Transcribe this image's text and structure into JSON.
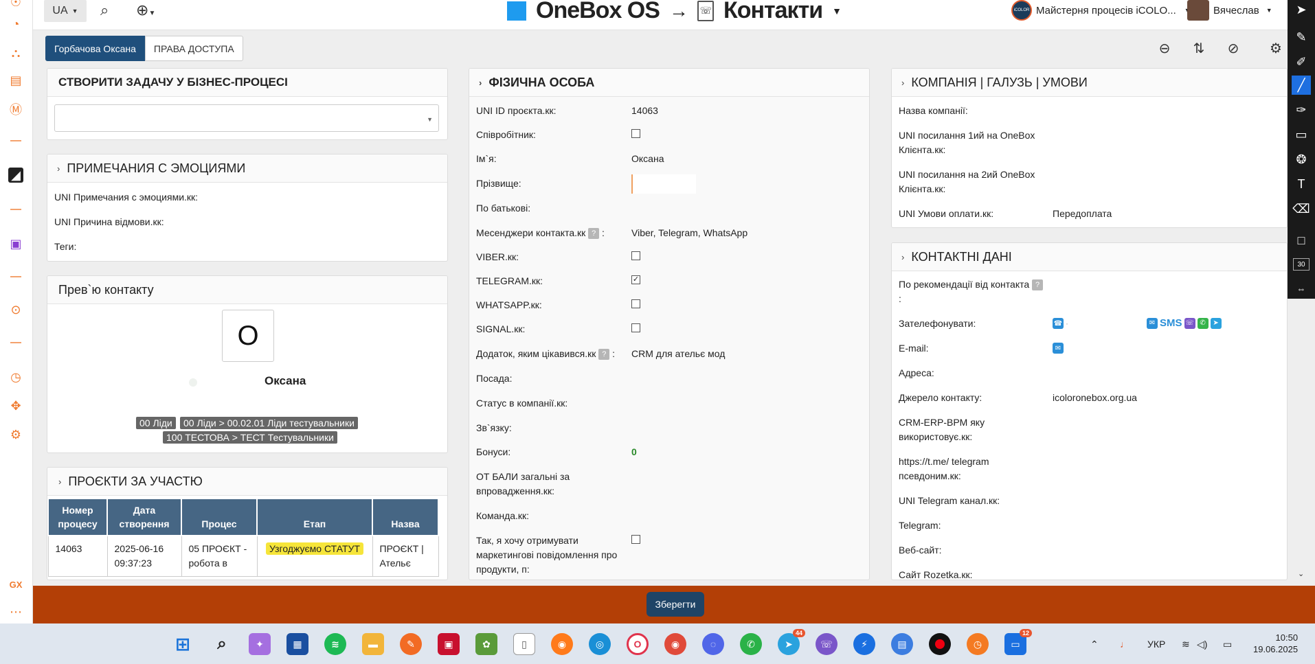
{
  "topbar": {
    "lang": "UA",
    "brand": "OneBox OS",
    "arrow": "→",
    "module": "Контакти",
    "company": "Майстерня процесів iCOLO...",
    "company_logo_text": "iCOLOR",
    "user": "Вячеслав"
  },
  "tabs": [
    "Горбачова Оксана",
    "ПРАВА ДОСТУПА"
  ],
  "task_panel": {
    "title": "СТВОРИТИ ЗАДАЧУ У БІЗНЕС-ПРОЦЕСІ",
    "select_value": ""
  },
  "notes_panel": {
    "title": "ПРИМЕЧАНИЯ С ЭМОЦИЯМИ",
    "fields": [
      "UNI Примечания с эмоциями.кк:",
      "UNI Причина відмови.кк:",
      "Теги:"
    ]
  },
  "preview_panel": {
    "title": "Прев`ю контакту",
    "avatar_letter": "О",
    "name": "Оксана",
    "tags": [
      "00 Ліди",
      "00 Ліди > 00.02.01 Ліди тестувальники",
      "100 ТЕСТОВА > ТЕСТ Тестувальники"
    ]
  },
  "projects_panel": {
    "title": "ПРОЄКТИ ЗА УЧАСТЮ",
    "columns": [
      "Номер процесу",
      "Дата створення",
      "Процес",
      "Етап",
      "Назва"
    ],
    "rows": [
      {
        "number": "14063",
        "date": "2025-06-16 09:37:23",
        "process": "05 ПРОЄКТ - робота в",
        "stage": "Узгоджуємо СТАТУТ",
        "name": "ПРОЄКТ | Ательє"
      }
    ]
  },
  "person_panel": {
    "title": "ФІЗИЧНА ОСОБА",
    "fields": {
      "uni_id_label": "UNI ID проєкта.кк:",
      "uni_id_value": "14063",
      "employee_label": "Співробітник:",
      "name_label": "Ім`я:",
      "name_value": "Оксана",
      "surname_label": "Прізвище:",
      "patronymic_label": "По батькові:",
      "messengers_label": "Месенджери контакта.кк",
      "messengers_value": "Viber, Telegram, WhatsApp",
      "viber_label": "VIBER.кк:",
      "telegram_label": "TELEGRAM.кк:",
      "telegram_checked": "✓",
      "whatsapp_label": "WHATSAPP.кк:",
      "signal_label": "SIGNAL.кк:",
      "app_label": "Додаток, яким цікавився.кк",
      "app_value": "CRM для ательє мод",
      "position_label": "Посада:",
      "company_status_label": "Статус в компанії.кк:",
      "relation_label": "Зв`язку:",
      "bonus_label": "Бонуси:",
      "bonus_value": "0",
      "points_label": "ОТ БАЛИ загальні за впровадження.кк:",
      "team_label": "Команда.кк:",
      "marketing_label": "Так, я хочу отримувати маркетингові повідомлення про продукти, п:",
      "colon": ":",
      "help": "?"
    }
  },
  "company_panel": {
    "title": "КОМПАНІЯ | ГАЛУЗЬ | УМОВИ",
    "company_name_label": "Назва компанії:",
    "link1_label": "UNI посилання 1ий на OneBox Клієнта.кк:",
    "link2_label": "UNI посилання на 2ий OneBox Клієнта.кк:",
    "payment_label": "UNI Умови оплати.кк:",
    "payment_value": "Передоплата"
  },
  "contacts_panel": {
    "title": "КОНТАКТНІ ДАНІ",
    "recommend_label": "По рекомендації від контакта",
    "recommend_colon": ":",
    "call_label": "Зателефонувати:",
    "call_dot": "·",
    "sms": "SMS",
    "email_label": "E-mail:",
    "address_label": "Адреса:",
    "source_label": "Джерело контакту:",
    "source_value": "icoloronebox.org.ua",
    "crm_label": "CRM-ERP-BPM яку використовує.кк:",
    "tg_link_label": "https://t.me/ telegram псевдоним.кк:",
    "tg_channel_label": "UNI Telegram канал.кк:",
    "telegram_label": "Telegram:",
    "website_label": "Веб-сайт:",
    "rozetka_label": "Сайт Rozetka.кк:"
  },
  "save_button": "Зберегти",
  "annot": {
    "size": "30"
  },
  "taskbar": {
    "badge_telegram": "44",
    "badge_last": "12",
    "lang": "УКР",
    "time": "10:50",
    "date": "19.06.2025"
  },
  "colors": {
    "accent": "#1f4f7c",
    "savebar": "#b33f06",
    "sidebar_icon": "#f07b2f",
    "stage": "#f6e53a",
    "table_head": "#466684"
  }
}
